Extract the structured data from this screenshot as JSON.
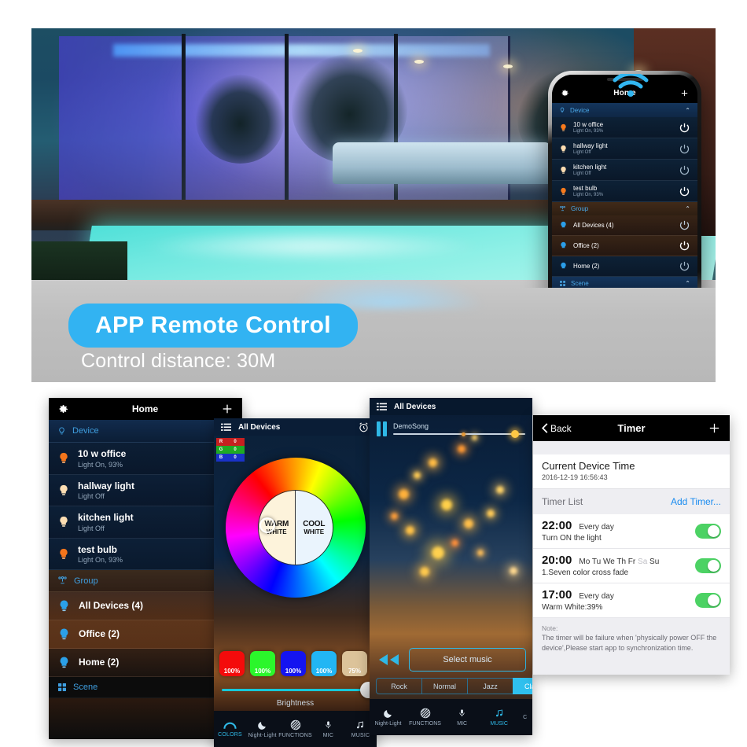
{
  "hero": {
    "wifi_icon": "wifi-icon",
    "phone": {
      "nav": {
        "gear_icon": "gear-icon",
        "title": "Home",
        "add_icon": "plus-icon"
      },
      "sections": [
        {
          "icon": "bulb-icon",
          "label": "Device",
          "chevron": "chevron-up-icon"
        },
        {
          "icon": "group-icon",
          "label": "Group",
          "chevron": "chevron-up-icon"
        },
        {
          "icon": "scene-icon",
          "label": "Scene",
          "chevron": "chevron-up-icon"
        }
      ],
      "devices": [
        {
          "name": "10 w office",
          "status": "Light On, 93%",
          "on": true
        },
        {
          "name": "hallway light",
          "status": "Light Off",
          "on": false
        },
        {
          "name": "kitchen light",
          "status": "Light Off",
          "on": false
        },
        {
          "name": "test bulb",
          "status": "Light On, 93%",
          "on": true
        }
      ],
      "groups": [
        {
          "name": "All Devices (4)",
          "on": false
        },
        {
          "name": "Office (2)",
          "on": true
        },
        {
          "name": "Home (2)",
          "on": false
        }
      ]
    }
  },
  "banner": {
    "headline": "APP Remote Control",
    "subline": "Control distance: 30M",
    "pill_color": "#32b3f2"
  },
  "home_panel": {
    "nav": {
      "gear_icon": "gear-icon",
      "title": "Home",
      "add_icon": "plus-icon"
    },
    "device_section": {
      "icon": "bulb-icon",
      "label": "Device",
      "chevron": "chevron-up-icon"
    },
    "devices": [
      {
        "name": "10 w office",
        "status": "Light On, 93%",
        "on": true
      },
      {
        "name": "hallway light",
        "status": "Light Off",
        "on": false
      },
      {
        "name": "kitchen light",
        "status": "Light Off",
        "on": false
      },
      {
        "name": "test bulb",
        "status": "Light On, 93%",
        "on": true
      }
    ],
    "group_section": {
      "icon": "group-icon",
      "label": "Group",
      "chevron": "chevron-up-icon"
    },
    "groups": [
      {
        "name": "All Devices (4)"
      },
      {
        "name": "Office (2)"
      },
      {
        "name": "Home (2)"
      }
    ],
    "scene_section": {
      "icon": "scene-icon",
      "label": "Scene",
      "chevron": "chevron-up-icon"
    }
  },
  "colors_panel": {
    "nav": {
      "menu_icon": "list-icon",
      "title": "All Devices",
      "alarm_icon": "alarm-clock-icon"
    },
    "rgb": {
      "r_key": "R",
      "r_val": "0",
      "g_key": "G",
      "g_val": "0",
      "b_key": "B",
      "b_val": "0"
    },
    "wheel": {
      "warm_line1": "WARM",
      "warm_line2": "WHITE",
      "cool_line1": "COOL",
      "cool_line2": "WHITE"
    },
    "swatches": [
      {
        "color": "#f40b0b",
        "label": "100%"
      },
      {
        "color": "#2bf62b",
        "label": "100%"
      },
      {
        "color": "#1414f0",
        "label": "100%"
      },
      {
        "color": "#22b6f4",
        "label": "100%"
      },
      {
        "color": "#dcc39a",
        "label": "75%"
      }
    ],
    "brightness_label": "Brightness",
    "tabs": [
      {
        "label": "COLORS",
        "icon": "colors-icon",
        "active": true
      },
      {
        "label": "Night-Light",
        "icon": "moon-icon",
        "active": false
      },
      {
        "label": "FUNCTIONS",
        "icon": "functions-icon",
        "active": false
      },
      {
        "label": "MIC",
        "icon": "mic-icon",
        "active": false
      },
      {
        "label": "MUSIC",
        "icon": "music-note-icon",
        "active": false
      }
    ]
  },
  "music_panel": {
    "nav": {
      "menu_icon": "list-icon",
      "title": "All Devices"
    },
    "pause_icon": "pause-icon",
    "song_name": "DemoSong",
    "rewind_icon": "rewind-icon",
    "select_music_label": "Select music",
    "genres": [
      {
        "label": "Rock",
        "active": false
      },
      {
        "label": "Normal",
        "active": false
      },
      {
        "label": "Jazz",
        "active": false
      },
      {
        "label": "Classic",
        "active": true
      }
    ],
    "tabs": [
      {
        "label": "Night-Light",
        "icon": "moon-icon",
        "active": false
      },
      {
        "label": "FUNCTIONS",
        "icon": "functions-icon",
        "active": false
      },
      {
        "label": "MIC",
        "icon": "mic-icon",
        "active": false
      },
      {
        "label": "MUSIC",
        "icon": "music-note-icon",
        "active": true
      },
      {
        "label": "C",
        "icon": "colors-icon",
        "active": false
      }
    ]
  },
  "timer_panel": {
    "nav": {
      "back_label": "Back",
      "back_icon": "chevron-left-icon",
      "title": "Timer",
      "add_icon": "plus-icon"
    },
    "current_time_heading": "Current Device Time",
    "current_time_value": "2016-12-19 16:56:43",
    "list_heading": "Timer List",
    "add_timer_label": "Add Timer...",
    "timers": [
      {
        "time": "22:00",
        "days": "Every day",
        "days_off": "",
        "desc": "Turn ON the light",
        "enabled": true
      },
      {
        "time": "20:00",
        "days": "Mo Tu We Th Fr",
        "days_off": "Sa",
        "days_tail": "Su",
        "desc": "1.Seven color cross fade",
        "enabled": true
      },
      {
        "time": "17:00",
        "days": "Every day",
        "days_off": "",
        "desc": "Warm White:39%",
        "enabled": true
      }
    ],
    "note_heading": "Note:",
    "note_body": "The timer will be failure when 'physically power OFF the device',Please start app to synchronization time."
  }
}
